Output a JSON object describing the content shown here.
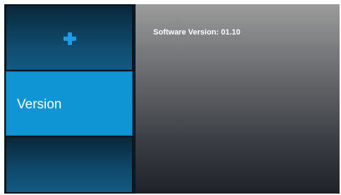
{
  "sidebar": {
    "items": [
      {
        "label": "",
        "icon": "plus-icon"
      },
      {
        "label": "Version"
      },
      {
        "label": ""
      }
    ]
  },
  "main": {
    "software_version_text": "Software Version: 01.10"
  },
  "colors": {
    "selected_item": "#0f95d3",
    "plus_icon": "#1e9be4",
    "sidebar_dark": "#0a2739"
  }
}
